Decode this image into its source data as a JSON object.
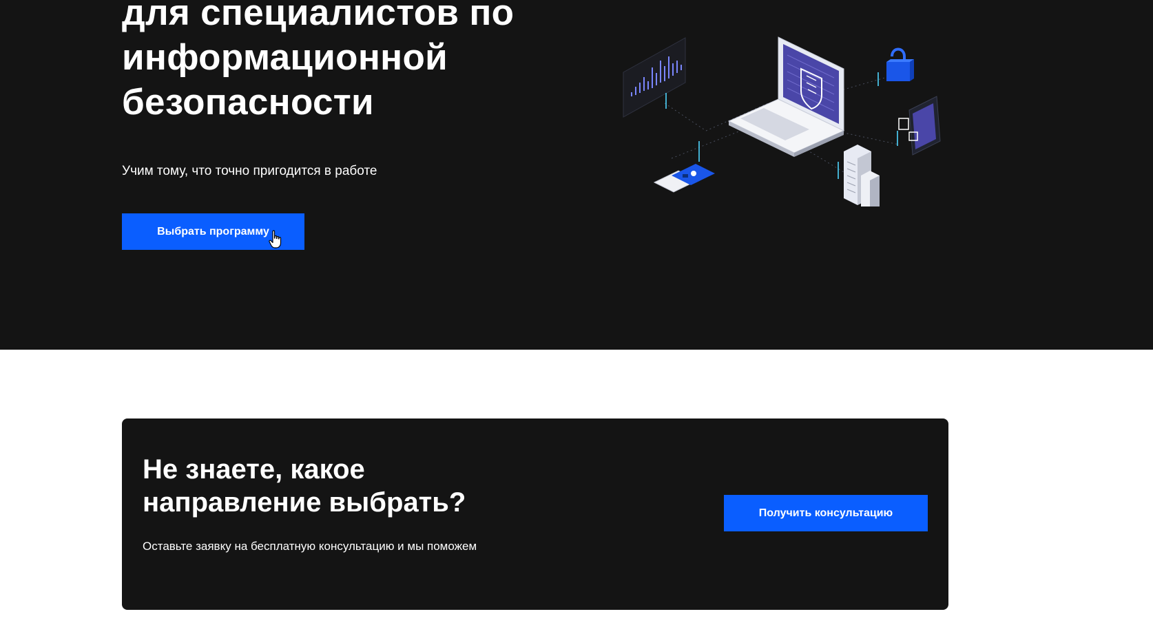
{
  "hero": {
    "title_lines": [
      "для специалистов по",
      "информационной",
      "безопасности"
    ],
    "subtitle": "Учим тому, что точно пригодится в работе",
    "button_label": "Выбрать программу"
  },
  "cta": {
    "title_lines": [
      "Не знаете, какое",
      "направление выбрать?"
    ],
    "text": "Оставьте заявку на бесплатную консультацию и мы поможем",
    "button_label": "Получить консультацию"
  },
  "colors": {
    "dark_background": "#141414",
    "accent": "#0a5eff",
    "text_light": "#ffffff",
    "page_background": "#ffffff"
  },
  "icons": {
    "illustration": "cybersecurity-isometric-illustration",
    "cursor": "hand-pointer-cursor"
  }
}
